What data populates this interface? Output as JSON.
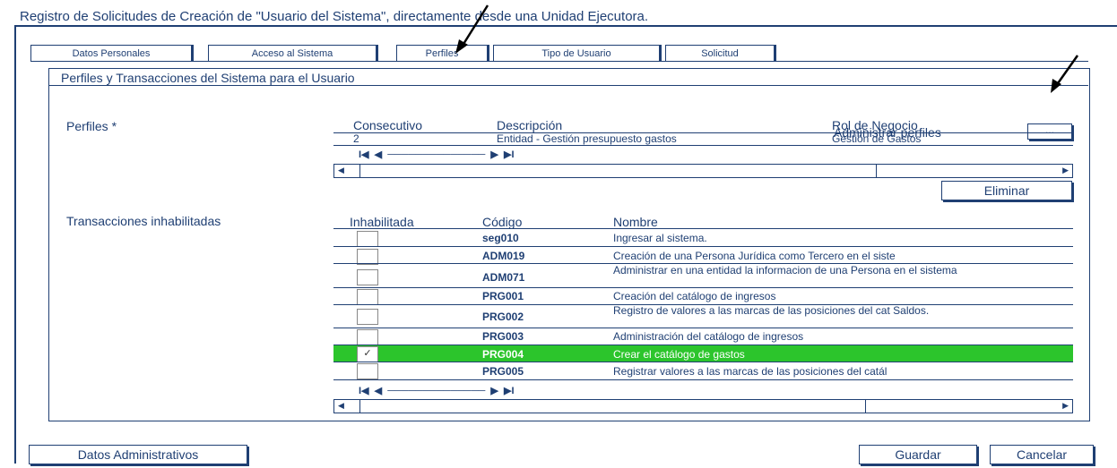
{
  "window": {
    "title": "Registro de Solicitudes de Creación de \"Usuario del Sistema\", directamente desde una Unidad Ejecutora."
  },
  "tabs": [
    {
      "label": "Datos Personales"
    },
    {
      "label": "Acceso al Sistema"
    },
    {
      "label": "Perfiles"
    },
    {
      "label": "Tipo de Usuario"
    },
    {
      "label": "Solicitud"
    }
  ],
  "panel": {
    "title": "Perfiles y Transacciones del Sistema para el Usuario"
  },
  "profiles": {
    "label": "Perfiles  *",
    "admin_label": "Administrar perfiles",
    "admin_button": "...",
    "columns": [
      "Consecutivo",
      "Descripción",
      "Rol de Negocio"
    ],
    "rows": [
      {
        "consecutivo": "2",
        "descripcion": "Entidad - Gestión presupuesto gastos",
        "rol": "Gestión de Gastos"
      }
    ],
    "pager": "I◀  ◀  ──────────────  ▶  ▶I",
    "delete_button": "Eliminar"
  },
  "transactions": {
    "label": "Transacciones inhabilitadas",
    "columns": [
      "Inhabilitada",
      "Código",
      "Nombre"
    ],
    "rows": [
      {
        "code": "seg010",
        "name": "Ingresar al sistema.",
        "checked": false
      },
      {
        "code": "ADM019",
        "name": "Creación de una Persona Jurídica como Tercero en el siste",
        "checked": false
      },
      {
        "code": "ADM071",
        "name": "Administrar en una entidad la informacion de una Persona en el sistema",
        "checked": false
      },
      {
        "code": "PRG001",
        "name": "Creación del catálogo de ingresos",
        "checked": false
      },
      {
        "code": "PRG002",
        "name": "Registro de valores a las marcas de las posiciones del cat Saldos.",
        "checked": false
      },
      {
        "code": "PRG003",
        "name": "Administración del catálogo de ingresos",
        "checked": false
      },
      {
        "code": "PRG004",
        "name": "Crear el catálogo de gastos",
        "checked": true
      },
      {
        "code": "PRG005",
        "name": "Registrar valores a las marcas de las posiciones del catál",
        "checked": false
      }
    ],
    "pager": "I◀  ◀  ──────────────  ▶  ▶I"
  },
  "footer": {
    "admin_button": "Datos Administrativos",
    "save_button": "Guardar",
    "cancel_button": "Cancelar"
  },
  "colors": {
    "primary": "#1f3f73",
    "selected_row": "#2cc52c"
  }
}
